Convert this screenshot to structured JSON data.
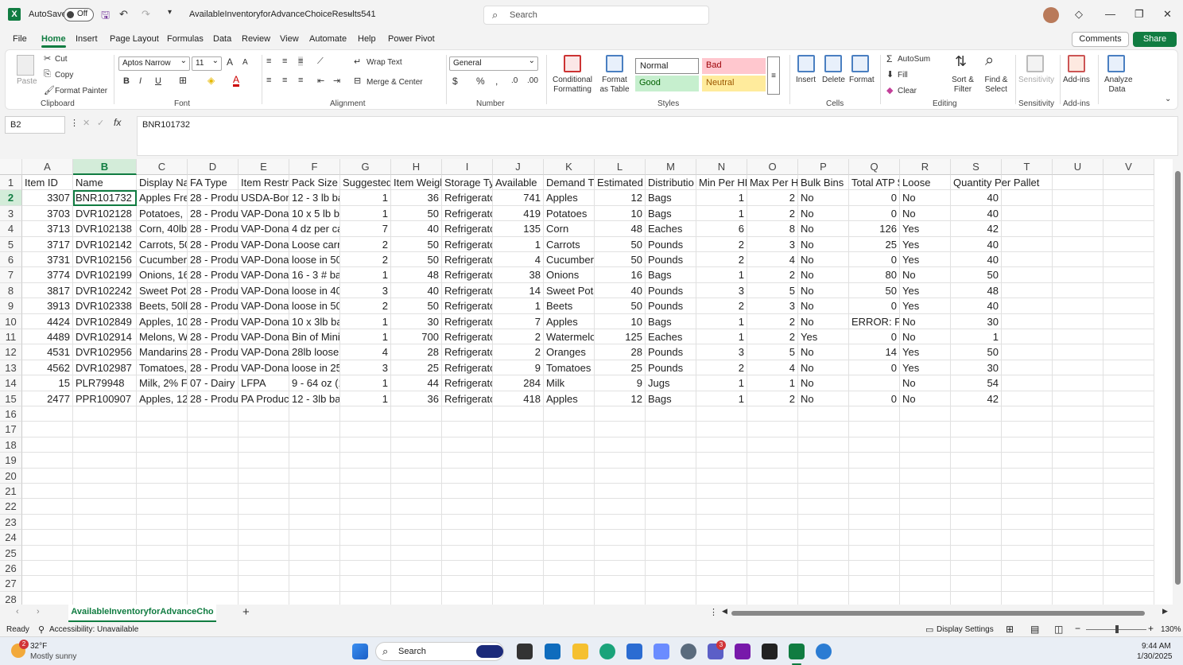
{
  "titlebar": {
    "autosave_label": "AutoSave",
    "autosave_state": "Off",
    "filename": "AvailableInventoryforAdvanceChoiceResults541",
    "search_placeholder": "Search"
  },
  "menu": [
    "File",
    "Home",
    "Insert",
    "Page Layout",
    "Formulas",
    "Data",
    "Review",
    "View",
    "Automate",
    "Help",
    "Power Pivot"
  ],
  "menu_active": "Home",
  "actions": {
    "comments": "Comments",
    "share": "Share"
  },
  "ribbon": {
    "clipboard": {
      "paste": "Paste",
      "cut": "Cut",
      "copy": "Copy",
      "format_painter": "Format Painter",
      "label": "Clipboard"
    },
    "font": {
      "name": "Aptos Narrow",
      "size": "11",
      "label": "Font"
    },
    "alignment": {
      "wrap": "Wrap Text",
      "merge": "Merge & Center",
      "label": "Alignment"
    },
    "number": {
      "format": "General",
      "label": "Number"
    },
    "styles": {
      "conditional": "Conditional Formatting",
      "format_table": "Format as Table",
      "normal": "Normal",
      "bad": "Bad",
      "good": "Good",
      "neutral": "Neutral",
      "label": "Styles"
    },
    "cells": {
      "insert": "Insert",
      "delete": "Delete",
      "format": "Format",
      "label": "Cells"
    },
    "editing": {
      "autosum": "AutoSum",
      "fill": "Fill",
      "clear": "Clear",
      "sort": "Sort & Filter",
      "find": "Find & Select",
      "label": "Editing"
    },
    "sensitivity": {
      "btn": "Sensitivity",
      "label": "Sensitivity"
    },
    "addins": {
      "btn": "Add-ins",
      "label": "Add-ins"
    },
    "analyze": {
      "btn": "Analyze Data"
    }
  },
  "formula": {
    "namebox": "B2",
    "fx": "fx",
    "content": "BNR101732"
  },
  "columns": [
    "A",
    "B",
    "C",
    "D",
    "E",
    "F",
    "G",
    "H",
    "I",
    "J",
    "K",
    "L",
    "M",
    "N",
    "O",
    "P",
    "Q",
    "R",
    "S",
    "T",
    "U",
    "V"
  ],
  "rows": [
    [
      "Item ID",
      "Name",
      "Display Na",
      "FA Type",
      "Item Restr",
      "Pack Size I",
      "Suggested",
      "Item Weigl",
      "Storage Ty",
      "Available",
      "Demand T",
      "Estimated",
      "Distributio",
      "Min Per HH",
      "Max Per HH",
      "Bulk Bins",
      "Total ATP $",
      "Loose",
      "Quantity Per Pallet"
    ],
    [
      "3307",
      "BNR101732",
      "Apples Fre",
      "28 - Produ",
      "USDA-Bon",
      "12 - 3 lb ba",
      "1",
      "36",
      "Refrigerato",
      "741",
      "Apples",
      "12",
      "Bags",
      "1",
      "2",
      "No",
      "0",
      "No",
      "40"
    ],
    [
      "3703",
      "DVR102128",
      "Potatoes,",
      "28 - Produ",
      "VAP-Dona",
      "10 x 5 lb b",
      "1",
      "50",
      "Refrigerato",
      "419",
      "Potatoes",
      "10",
      "Bags",
      "1",
      "2",
      "No",
      "0",
      "No",
      "40"
    ],
    [
      "3713",
      "DVR102138",
      "Corn, 40lb",
      "28 - Produ",
      "VAP-Dona",
      "4 dz per ca",
      "7",
      "40",
      "Refrigerato",
      "135",
      "Corn",
      "48",
      "Eaches",
      "6",
      "8",
      "No",
      "126",
      "Yes",
      "42"
    ],
    [
      "3717",
      "DVR102142",
      "Carrots, 50",
      "28 - Produ",
      "VAP-Dona",
      "Loose carr",
      "2",
      "50",
      "Refrigerato",
      "1",
      "Carrots",
      "50",
      "Pounds",
      "2",
      "3",
      "No",
      "25",
      "Yes",
      "40"
    ],
    [
      "3731",
      "DVR102156",
      "Cucumber",
      "28 - Produ",
      "VAP-Dona",
      "loose in 50",
      "2",
      "50",
      "Refrigerato",
      "4",
      "Cucumber",
      "50",
      "Pounds",
      "2",
      "4",
      "No",
      "0",
      "Yes",
      "40"
    ],
    [
      "3774",
      "DVR102199",
      "Onions, 16",
      "28 - Produ",
      "VAP-Dona",
      "16 - 3 # ba",
      "1",
      "48",
      "Refrigerato",
      "38",
      "Onions",
      "16",
      "Bags",
      "1",
      "2",
      "No",
      "80",
      "No",
      "50"
    ],
    [
      "3817",
      "DVR102242",
      "Sweet Pota",
      "28 - Produ",
      "VAP-Dona",
      "loose in 40",
      "3",
      "40",
      "Refrigerato",
      "14",
      "Sweet Pota",
      "40",
      "Pounds",
      "3",
      "5",
      "No",
      "50",
      "Yes",
      "48"
    ],
    [
      "3913",
      "DVR102338",
      "Beets, 50lb",
      "28 - Produ",
      "VAP-Dona",
      "loose in 50",
      "2",
      "50",
      "Refrigerato",
      "1",
      "Beets",
      "50",
      "Pounds",
      "2",
      "3",
      "No",
      "0",
      "Yes",
      "40"
    ],
    [
      "4424",
      "DVR102849",
      "Apples, 10",
      "28 - Produ",
      "VAP-Dona",
      "10 x 3lb ba",
      "1",
      "30",
      "Refrigerato",
      "7",
      "Apples",
      "10",
      "Bags",
      "1",
      "2",
      "No",
      "ERROR: Fi",
      "No",
      "30"
    ],
    [
      "4489",
      "DVR102914",
      "Melons, W",
      "28 - Produ",
      "VAP-Dona",
      "Bin of Mini",
      "1",
      "700",
      "Refrigerato",
      "2",
      "Watermelo",
      "125",
      "Eaches",
      "1",
      "2",
      "Yes",
      "0",
      "No",
      "1"
    ],
    [
      "4531",
      "DVR102956",
      "Mandarins",
      "28 - Produ",
      "VAP-Dona",
      "28lb loose",
      "4",
      "28",
      "Refrigerato",
      "2",
      "Oranges",
      "28",
      "Pounds",
      "3",
      "5",
      "No",
      "14",
      "Yes",
      "50"
    ],
    [
      "4562",
      "DVR102987",
      "Tomatoes,",
      "28 - Produ",
      "VAP-Dona",
      "loose in 25",
      "3",
      "25",
      "Refrigerato",
      "9",
      "Tomatoes",
      "25",
      "Pounds",
      "2",
      "4",
      "No",
      "0",
      "Yes",
      "30"
    ],
    [
      "15",
      "PLR79948",
      "Milk, 2% F",
      "07 - Dairy",
      "LFPA",
      "9 - 64 oz (1",
      "1",
      "44",
      "Refrigerato",
      "284",
      "Milk",
      "9",
      "Jugs",
      "1",
      "1",
      "No",
      "",
      "No",
      "54"
    ],
    [
      "2477",
      "PPR100907",
      "Apples, 12",
      "28 - Produ",
      "PA Produc",
      "12 - 3lb ba",
      "1",
      "36",
      "Refrigerato",
      "418",
      "Apples",
      "12",
      "Bags",
      "1",
      "2",
      "No",
      "0",
      "No",
      "42"
    ]
  ],
  "row_numbers": [
    "1",
    "2",
    "3",
    "4",
    "5",
    "6",
    "7",
    "8",
    "9",
    "10",
    "11",
    "12",
    "13",
    "14",
    "15",
    "16",
    "17",
    "18",
    "19",
    "20",
    "21",
    "22",
    "23",
    "24",
    "25",
    "26",
    "27",
    "28"
  ],
  "sheet_tab": "AvailableInventoryforAdvanceCho",
  "status": {
    "ready": "Ready",
    "accessibility": "Accessibility: Unavailable",
    "display": "Display Settings",
    "zoom": "130%"
  },
  "taskbar": {
    "temp": "32°F",
    "weather": "Mostly sunny",
    "search": "Search",
    "time": "9:44 AM",
    "date": "1/30/2025",
    "badge_weather": "2",
    "badge_teams": "3"
  }
}
